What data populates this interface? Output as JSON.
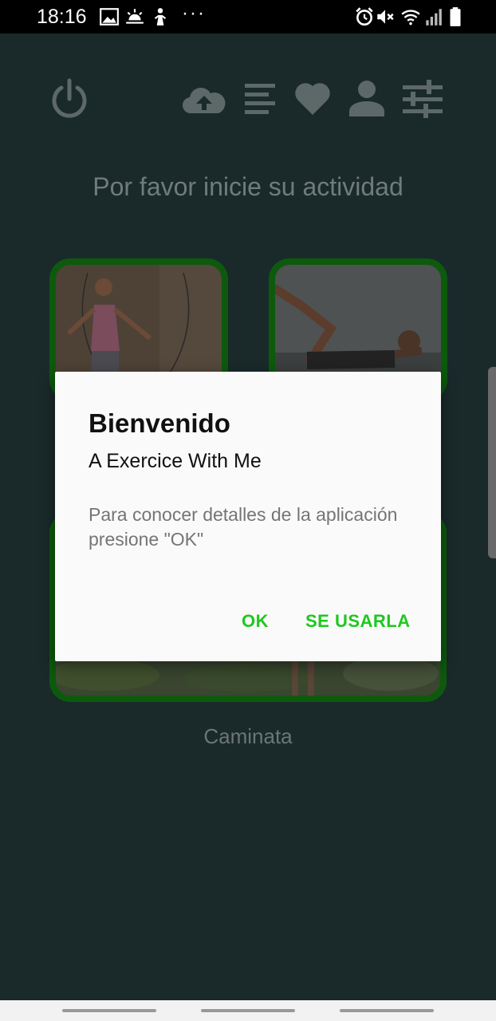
{
  "status_bar": {
    "time": "18:16",
    "more_indicator": "···"
  },
  "toolbar": {
    "icons": [
      "power-icon",
      "cloud-upload-icon",
      "list-icon",
      "heart-icon",
      "person-icon",
      "sliders-icon"
    ]
  },
  "main": {
    "headline": "Por favor inicie su actividad",
    "activities": [
      {
        "label": ""
      },
      {
        "label": ""
      },
      {
        "label": "Caminata"
      }
    ]
  },
  "dialog": {
    "title": "Bienvenido",
    "subtitle": "A Exercice With Me",
    "message": "Para conocer detalles de la aplicación presione \"OK\"",
    "buttons": {
      "ok": "OK",
      "secondary": "SE USARLA"
    }
  },
  "colors": {
    "background": "#1a2a2a",
    "card_border": "#0d5a0d",
    "dialog_accent": "#1ec81e"
  }
}
